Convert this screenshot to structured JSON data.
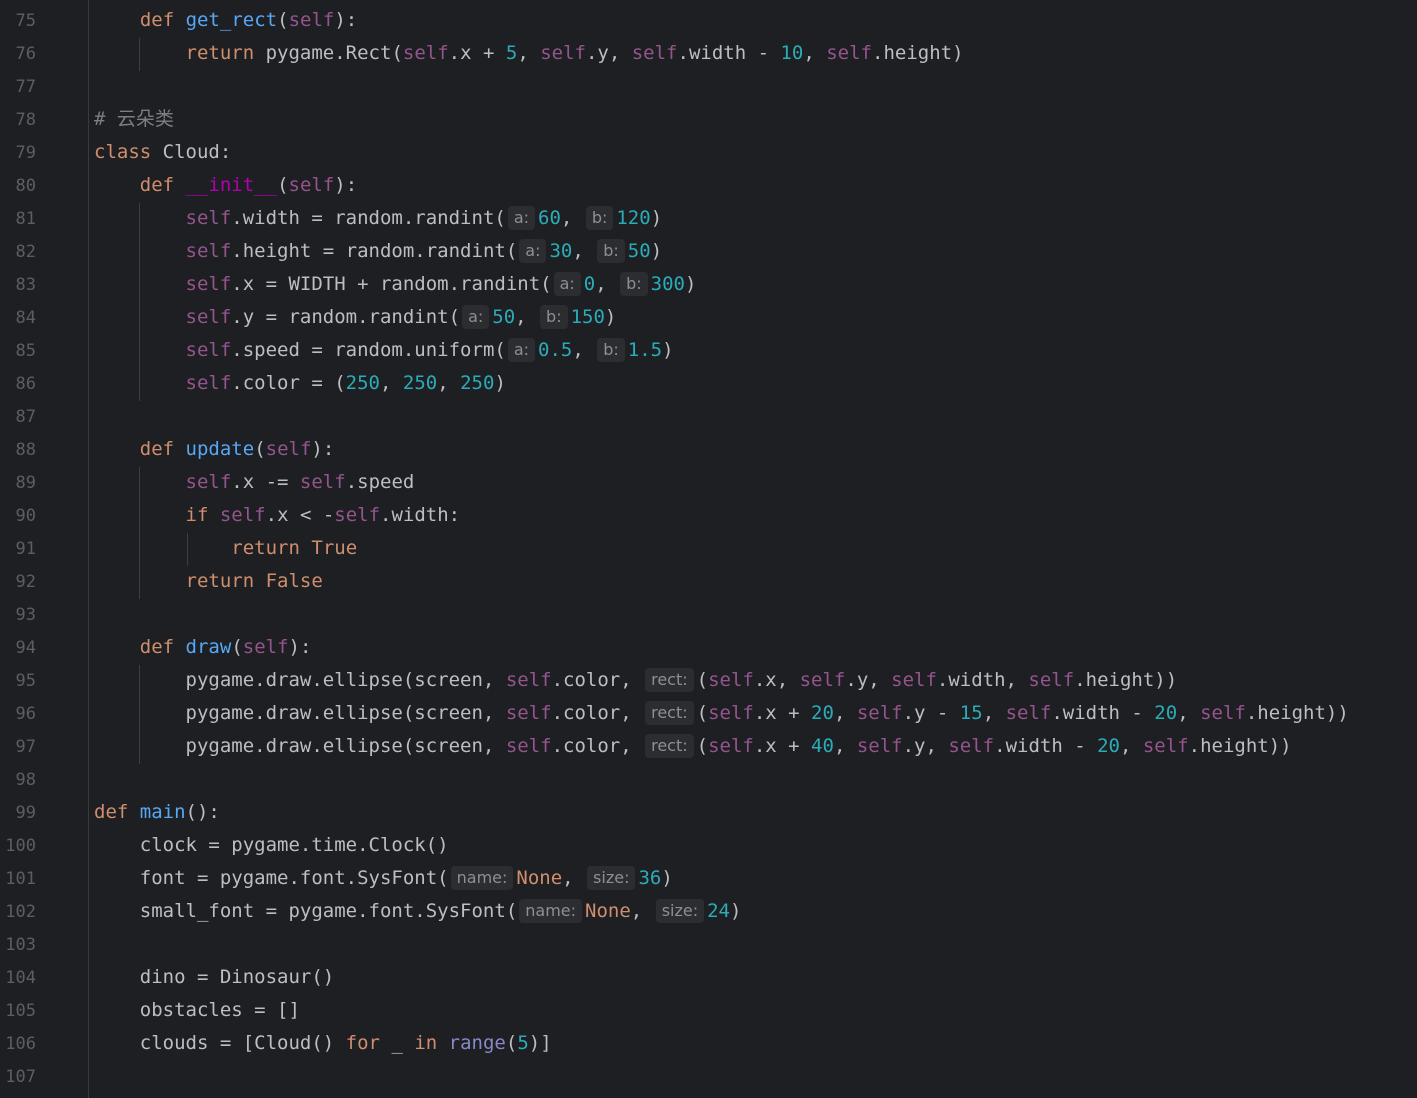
{
  "editor": {
    "gutter": {
      "line_numbers": [
        "75",
        "76",
        "77",
        "78",
        "79",
        "80",
        "81",
        "82",
        "83",
        "84",
        "85",
        "86",
        "87",
        "88",
        "89",
        "90",
        "91",
        "92",
        "93",
        "94",
        "95",
        "96",
        "97",
        "98",
        "99",
        "100",
        "101",
        "102",
        "103",
        "104",
        "105",
        "106",
        "107"
      ]
    },
    "hints": {
      "a": "a:",
      "b": "b:",
      "rect": "rect:",
      "name": "name:",
      "size": "size:"
    },
    "tokens": {
      "def": "def",
      "class": "class",
      "return": "return",
      "if": "if",
      "for": "for",
      "in": "in",
      "self": "self",
      "true": "True",
      "false": "False",
      "none": "None",
      "comment_cloud": "# 云朵类",
      "get_rect": "get_rect",
      "init": "__init__",
      "update": "update",
      "draw": "draw",
      "main": "main",
      "range": "range",
      "cloud_class": "Cloud:",
      "params_self": "(self):",
      "params_open": "(",
      "main_params": "():",
      "l76_a": "pygame.Rect(",
      "l76_b": ".x + ",
      "l76_c": ".y, ",
      "l76_d": ".width - ",
      "l76_e": ".height)",
      "n5": "5",
      "n10": "10",
      "n60": "60",
      "n120": "120",
      "n30": "30",
      "n50": "50",
      "n0": "0",
      "n300": "300",
      "n150": "150",
      "n0_5": "0.5",
      "n1_5": "1.5",
      "n250": "250",
      "n20": "20",
      "n15": "15",
      "n40": "40",
      "n36": "36",
      "n24": "24",
      "comma_sp": ", ",
      "close_paren": ")",
      "l81_a": ".width = random.randint(",
      "l82_a": ".height = random.randint(",
      "l83_a": ".x = WIDTH + random.randint(",
      "l84_a": ".y = random.randint(",
      "l85_a": ".speed = random.uniform(",
      "l86_a": ".color = (",
      "l89_a": ".x -= ",
      "l89_b": ".speed",
      "l90_a": ".x < -",
      "l90_b": ".width:",
      "l95_a": "pygame.draw.ellipse(screen, ",
      "l95_b": ".color, ",
      "paren_open": "(",
      "dot_x_comma": ".x, ",
      "dot_y_comma": ".y, ",
      "dot_width_comma": ".width, ",
      "dot_height_close": ".height))",
      "dot_x_plus": ".x + ",
      "dot_y_minus": ".y - ",
      "dot_width_minus": ".width - ",
      "l100": "clock = pygame.time.Clock()",
      "l101_a": "font = pygame.font.SysFont(",
      "l102_a": "small_font = pygame.font.SysFont(",
      "l104": "dino = Dinosaur()",
      "l105": "obstacles = []",
      "l106_a": "clouds = [Cloud() ",
      "l106_b": " _ ",
      "l106_c": "(",
      "l106_d": ")]",
      "sp": " "
    }
  }
}
